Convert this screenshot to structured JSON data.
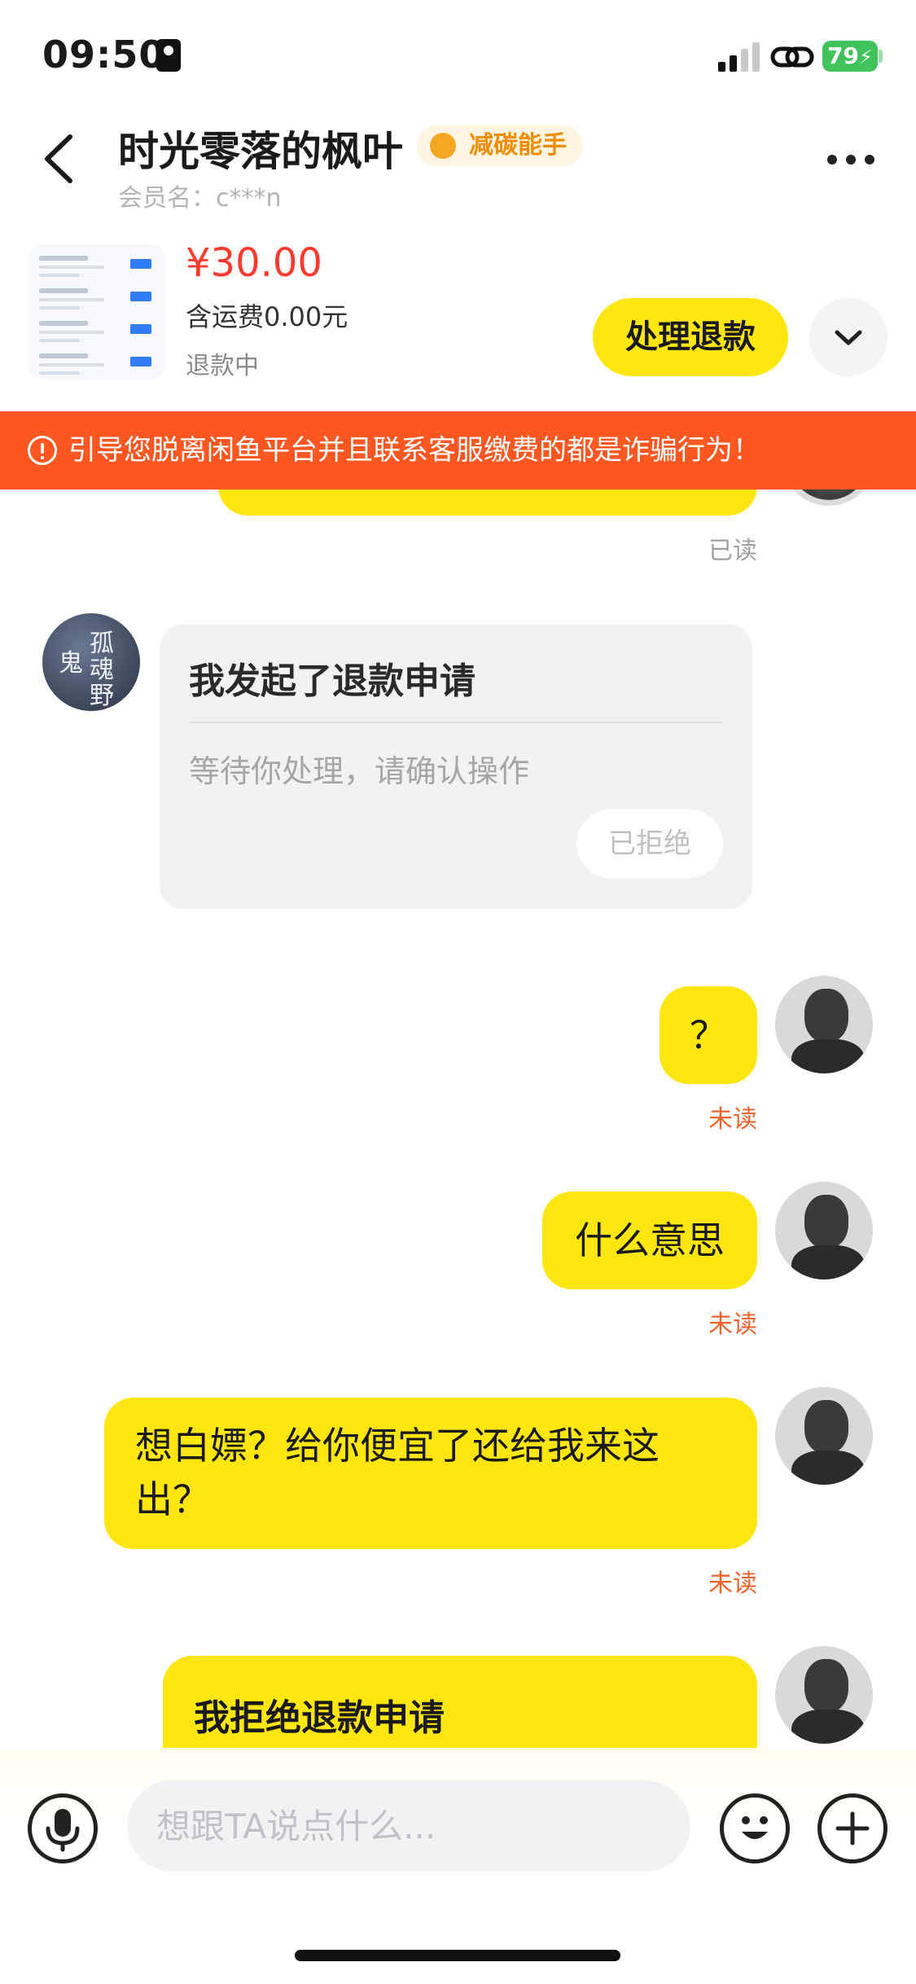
{
  "status_bar": {
    "time": "09:50",
    "battery": "79"
  },
  "header": {
    "title": "时光零落的枫叶",
    "badge": "减碳能手",
    "member": "会员名：c***n"
  },
  "product": {
    "price": "¥30.00",
    "shipping": "含运费0.00元",
    "status": "退款中",
    "action": "处理退款"
  },
  "warning": "引导您脱离闲鱼平台并且联系客服缴费的都是诈骗行为！",
  "chat": {
    "read_label": "已读",
    "refund_card": {
      "title": "我发起了退款申请",
      "desc": "等待你处理，请确认操作",
      "button": "已拒绝"
    },
    "left_avatar_text": [
      "孤",
      "魂",
      "鬼",
      "野"
    ],
    "messages": [
      {
        "text": "？",
        "status": "未读"
      },
      {
        "text": "什么意思",
        "status": "未读"
      },
      {
        "text": "想白嫖？给你便宜了还给我来这出？",
        "status": "未读"
      }
    ],
    "last_card_title": "我拒绝退款申请"
  },
  "input": {
    "placeholder": "想跟TA说点什么..."
  },
  "colors": {
    "accent": "#ffe60f",
    "warning": "#ff5722",
    "price": "#ff3b30",
    "unread": "#f2622b"
  }
}
